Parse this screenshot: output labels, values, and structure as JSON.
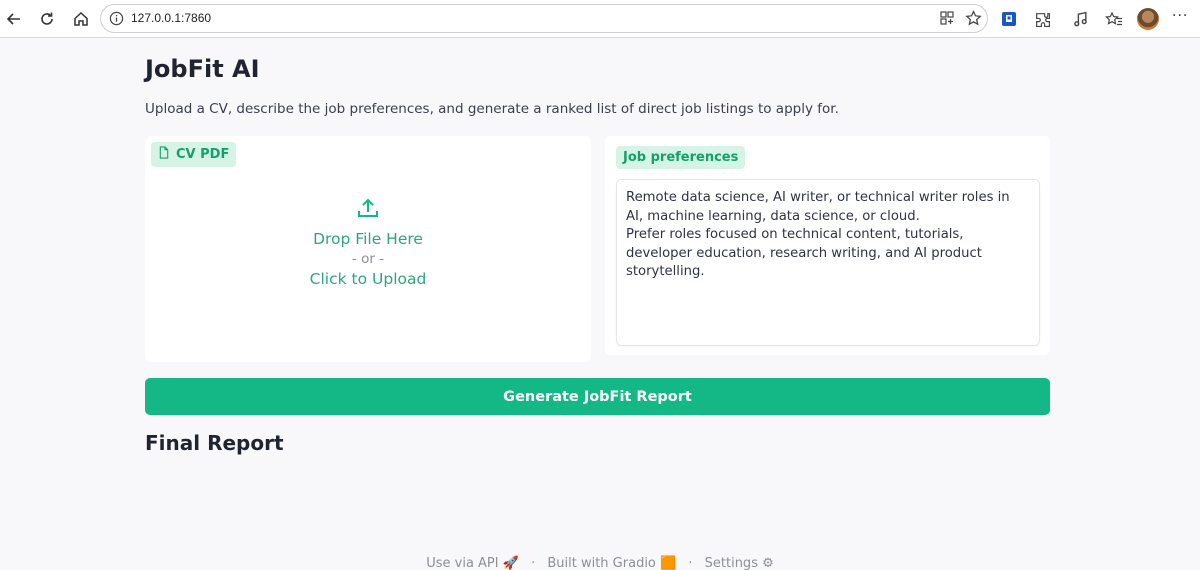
{
  "browser": {
    "url": "127.0.0.1:7860"
  },
  "page": {
    "title": "JobFit AI",
    "description": "Upload a CV, describe the job preferences, and generate a ranked list of direct job listings to apply for."
  },
  "upload": {
    "label": "CV PDF",
    "drop_text": "Drop File Here",
    "or_text": "- or -",
    "click_text": "Click to Upload"
  },
  "preferences": {
    "label": "Job preferences",
    "value": "Remote data science, AI writer, or technical writer roles in AI, machine learning, data science, or cloud.\nPrefer roles focused on technical content, tutorials, developer education, research writing, and AI product storytelling."
  },
  "generate_button": {
    "label": "Generate JobFit Report"
  },
  "report": {
    "title": "Final Report"
  },
  "footer": {
    "api_label": "Use via API",
    "api_emoji": "🚀",
    "built_label": "Built with Gradio",
    "built_emoji": "🟧",
    "settings_label": "Settings",
    "settings_emoji": "⚙",
    "separator": "·"
  },
  "colors": {
    "accent": "#14b886",
    "pill_bg": "#d6f4e6",
    "pill_text": "#15a06b"
  }
}
